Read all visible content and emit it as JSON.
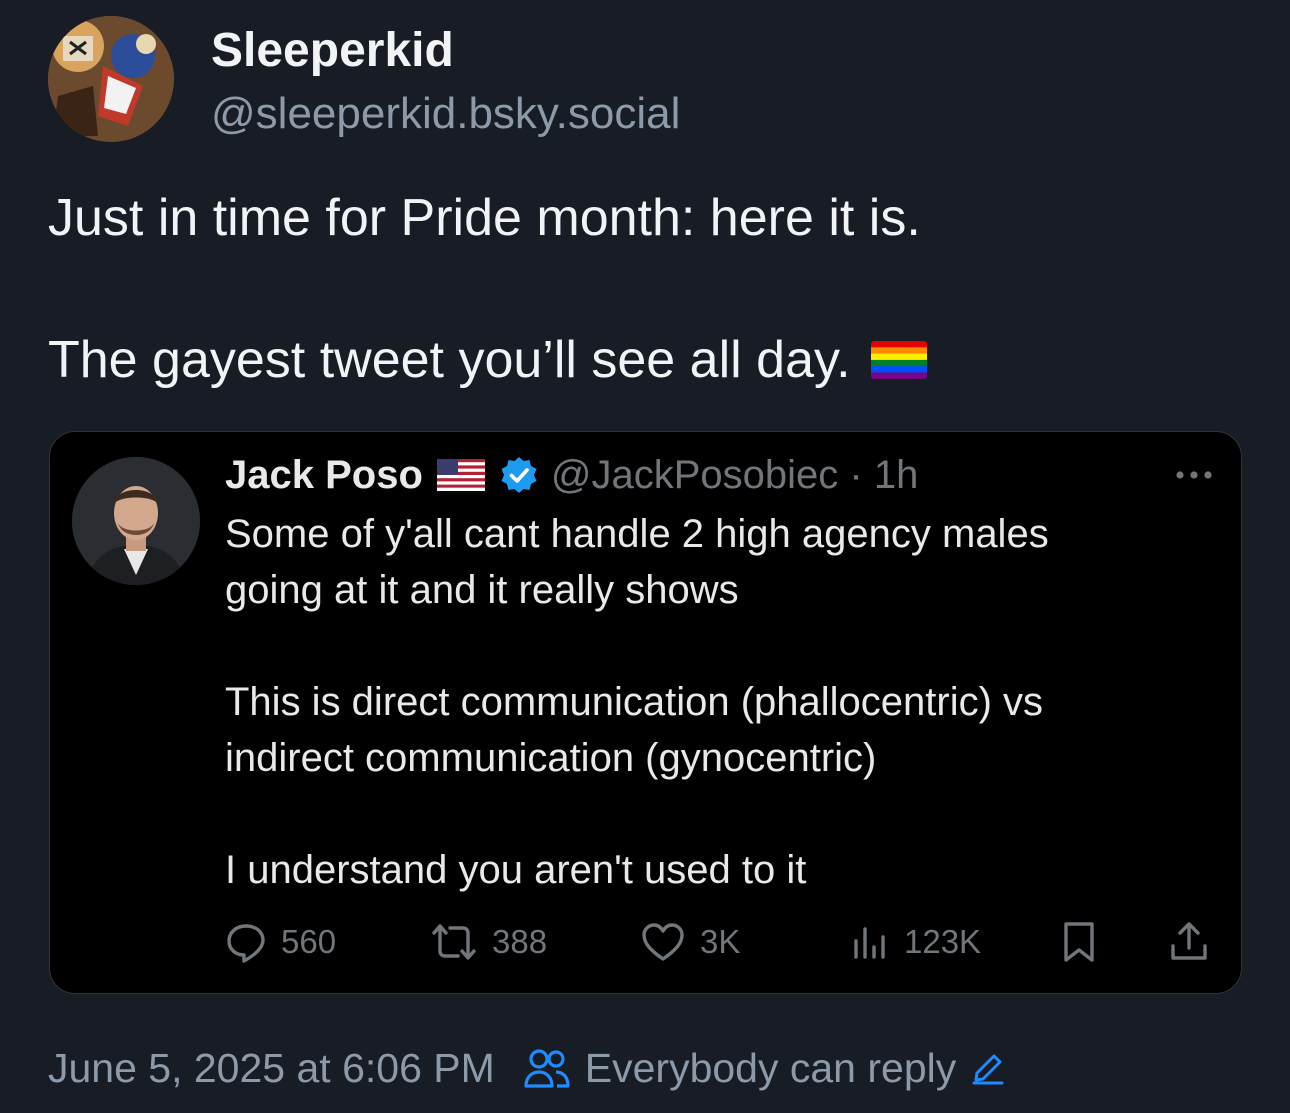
{
  "author": {
    "display_name": "Sleeperkid",
    "handle": "@sleeperkid.bsky.social",
    "avatar_icon": "comic-art-avatar-icon"
  },
  "post": {
    "line1": "Just in time for Pride month: here it is.",
    "line2": "The gayest tweet you’ll see all day.",
    "emoji_icon": "rainbow-flag-icon"
  },
  "quoted_tweet": {
    "display_name": "Jack Poso",
    "flag_icon": "us-flag-icon",
    "verified_icon": "verified-badge-icon",
    "handle_time": "@JackPosobiec · 1h",
    "body": [
      "Some of y'all cant handle 2 high agency males",
      "going at it and it really shows",
      "This is direct communication (phallocentric) vs",
      "indirect communication (gynocentric)",
      "I understand you aren't used to it"
    ],
    "stats": {
      "replies": "560",
      "reposts": "388",
      "likes": "3K",
      "views": "123K"
    }
  },
  "footer": {
    "timestamp": "June 5, 2025 at 6:06 PM",
    "reply_setting": "Everybody can reply"
  },
  "colors": {
    "background": "#171c25",
    "text": "#f1f3f5",
    "muted": "#8c9aa9",
    "embed_background": "#000000",
    "verified_blue": "#1d9bf0",
    "link_blue": "#208bfe"
  }
}
